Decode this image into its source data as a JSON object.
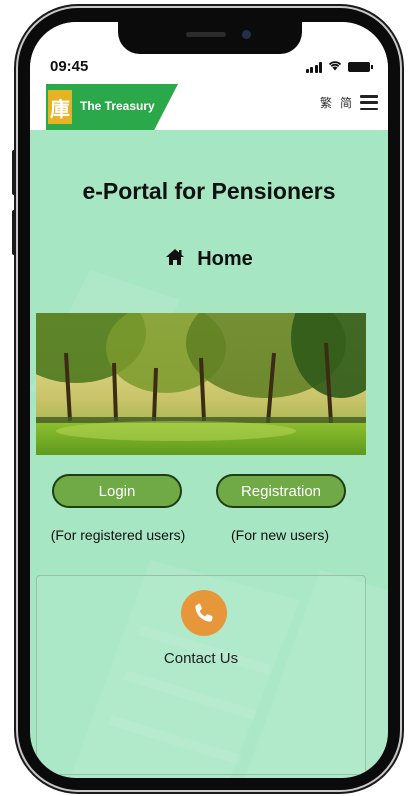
{
  "status_bar": {
    "time": "09:45"
  },
  "header": {
    "logo_mark": "庫",
    "logo_text": "The Treasury",
    "lang_traditional": "繁",
    "lang_simplified": "简",
    "icons": [
      "hamburger-icon"
    ]
  },
  "main": {
    "title": "e-Portal for Pensioners",
    "home_label": "Home",
    "home_icon": "house-icon",
    "hero_image": "park-with-trees-photo"
  },
  "actions": {
    "login_label": "Login",
    "login_sub": "(For registered users)",
    "register_label": "Registration",
    "register_sub": "(For new users)"
  },
  "contact": {
    "label": "Contact Us",
    "icon": "phone-icon"
  },
  "colors": {
    "background": "#a6e6c3",
    "button": "#6faa46",
    "button_border": "#1f3d12",
    "brand_green": "#2aa84a",
    "brand_gold": "#e6b322",
    "contact_icon": "#e8963a"
  }
}
